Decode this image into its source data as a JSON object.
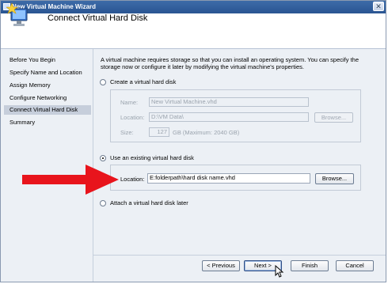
{
  "window": {
    "title": "New Virtual Machine Wizard",
    "close_glyph": "✕"
  },
  "header": {
    "title": "Connect Virtual Hard Disk",
    "icon": "computer-star-icon"
  },
  "sidebar": {
    "items": [
      {
        "label": "Before You Begin",
        "selected": false
      },
      {
        "label": "Specify Name and Location",
        "selected": false
      },
      {
        "label": "Assign Memory",
        "selected": false
      },
      {
        "label": "Configure Networking",
        "selected": false
      },
      {
        "label": "Connect Virtual Hard Disk",
        "selected": true
      },
      {
        "label": "Summary",
        "selected": false
      }
    ]
  },
  "main": {
    "description": "A virtual machine requires storage so that you can install an operating system. You can specify the storage now or configure it later by modifying the virtual machine's properties.",
    "create_option": {
      "label": "Create a virtual hard disk",
      "checked": false,
      "name_label": "Name:",
      "name_value": "New Virtual Machine.vhd",
      "location_label": "Location:",
      "location_value": "D:\\VM Data\\",
      "browse_label": "Browse...",
      "size_label": "Size:",
      "size_value": "127",
      "size_note": "GB (Maximum: 2040 GB)"
    },
    "existing_option": {
      "label": "Use an existing virtual hard disk",
      "checked": true,
      "location_label": "Location:",
      "location_value": "E:folderpath\\hard disk name.vhd",
      "browse_label": "Browse..."
    },
    "later_option": {
      "label": "Attach a virtual hard disk later",
      "checked": false
    }
  },
  "annotation": {
    "arrow_color": "#e8141c"
  },
  "footer": {
    "previous_label": "< Previous",
    "next_label": "Next >",
    "finish_label": "Finish",
    "cancel_label": "Cancel"
  }
}
